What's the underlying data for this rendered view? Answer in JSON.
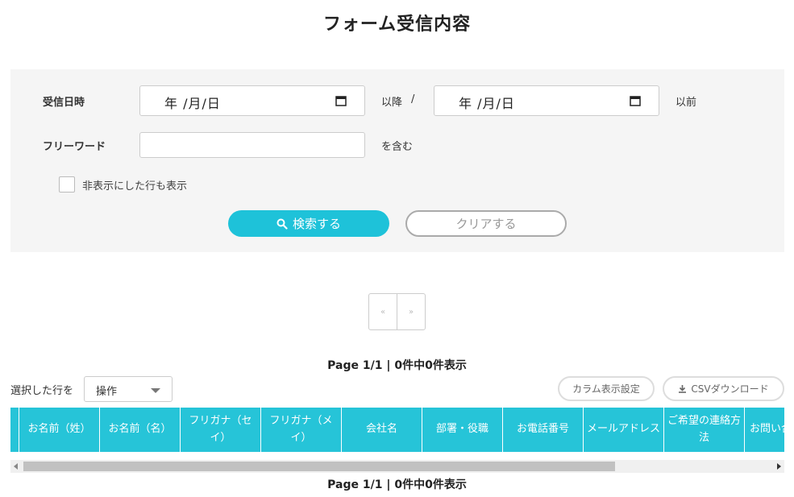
{
  "page": {
    "title": "フォーム受信内容"
  },
  "filters": {
    "date_label": "受信日時",
    "date_from_value": "年 /月/日",
    "after_text": "以降",
    "separator": "/",
    "date_to_value": "年 /月/日",
    "before_text": "以前",
    "freeword_label": "フリーワード",
    "freeword_value": "",
    "contains_text": "を含む",
    "show_hidden_label": "非表示にした行も表示",
    "search_button": "検索する",
    "clear_button": "クリアする"
  },
  "pagination": {
    "prev": "«",
    "next": "»",
    "info_top": "Page 1/1 | 0件中0件表示",
    "info_bottom": "Page 1/1 | 0件中0件表示"
  },
  "bulk": {
    "label": "選択した行を",
    "select_value": "操作"
  },
  "toolbar": {
    "column_settings": "カラム表示設定",
    "csv_download": "CSVダウンロード"
  },
  "table": {
    "columns": [
      "お名前（姓）",
      "お名前（名）",
      "フリガナ（セイ）",
      "フリガナ（メイ）",
      "会社名",
      "部署・役職",
      "お電話番号",
      "メールアドレス",
      "ご希望の連絡方法",
      "お問い合"
    ]
  },
  "colors": {
    "accent": "#1ec2d9",
    "header_bg": "#26c4d8",
    "panel_bg": "#f5f5f5"
  },
  "icons": [
    "calendar-icon",
    "search-icon",
    "download-icon",
    "chevron-down-icon"
  ]
}
